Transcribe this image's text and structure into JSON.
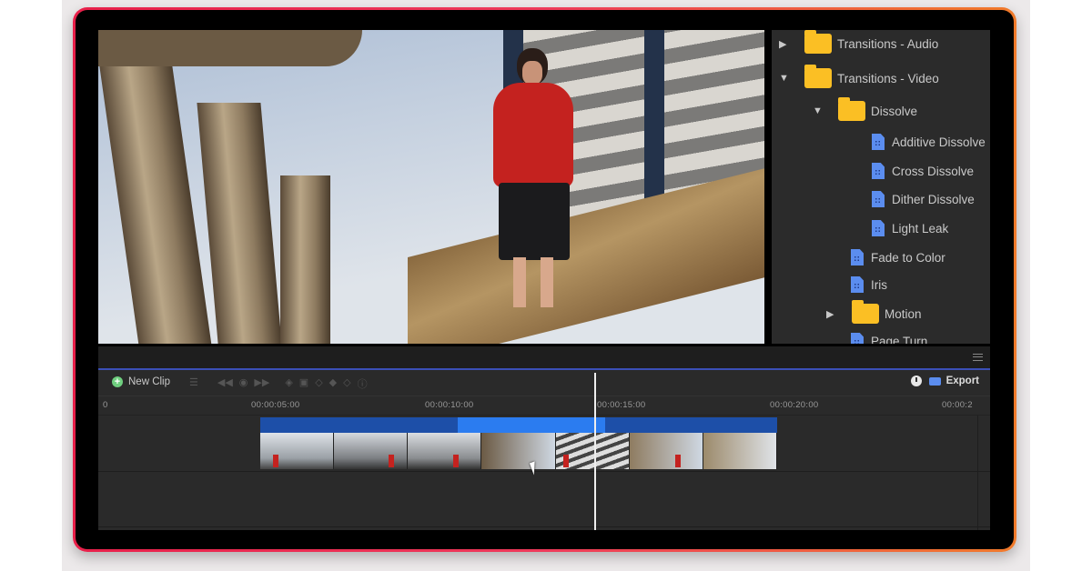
{
  "browser": {
    "items": [
      {
        "label": "Transitions - Audio",
        "type": "folder",
        "expanded": false,
        "level": 0
      },
      {
        "label": "Transitions - Video",
        "type": "folder",
        "expanded": true,
        "level": 0
      },
      {
        "label": "Dissolve",
        "type": "folder",
        "expanded": true,
        "level": 1
      },
      {
        "label": "Additive Dissolve",
        "type": "file",
        "level": 2
      },
      {
        "label": "Cross Dissolve",
        "type": "file",
        "level": 2
      },
      {
        "label": "Dither Dissolve",
        "type": "file",
        "level": 2
      },
      {
        "label": "Light Leak",
        "type": "file",
        "level": 2
      },
      {
        "label": "Fade to Color",
        "type": "file",
        "level": 1
      },
      {
        "label": "Iris",
        "type": "file",
        "level": 1
      },
      {
        "label": "Motion",
        "type": "folder",
        "expanded": false,
        "level": 1
      },
      {
        "label": "Page Turn",
        "type": "file",
        "level": 1
      }
    ]
  },
  "toolbar": {
    "new_clip_label": "New Clip",
    "export_label": "Export"
  },
  "ruler": {
    "ticks": [
      "0",
      "00:00:05:00",
      "00:00:10:00",
      "00:00:15:00",
      "00:00:20:00",
      "00:00:2"
    ]
  },
  "colors": {
    "accent": "#2b7cf0",
    "clip": "#1d4fa8",
    "folder": "#fbbf24",
    "file": "#5b8def",
    "frame_start": "#e8204a",
    "frame_end": "#f07a2a"
  },
  "playhead": "00:00:15:00"
}
